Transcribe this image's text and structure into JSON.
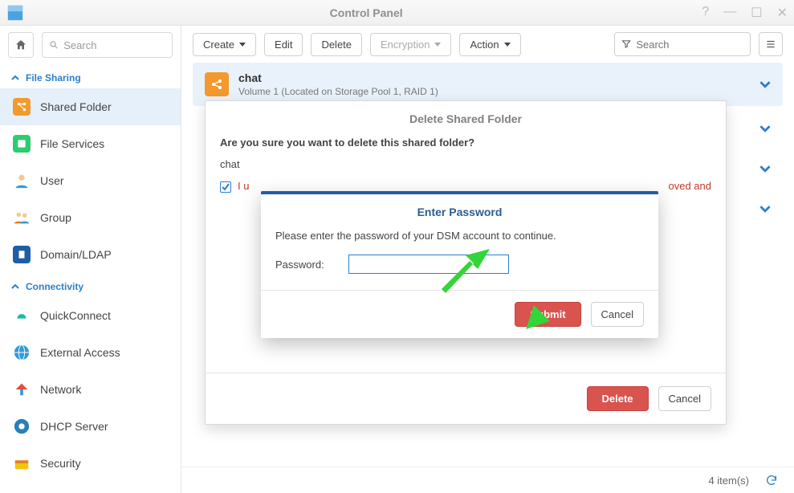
{
  "window": {
    "title": "Control Panel"
  },
  "sidebar": {
    "search_placeholder": "Search",
    "sections": {
      "file_sharing": {
        "label": "File Sharing",
        "items": [
          {
            "label": "Shared Folder",
            "active": true
          },
          {
            "label": "File Services"
          },
          {
            "label": "User"
          },
          {
            "label": "Group"
          },
          {
            "label": "Domain/LDAP"
          }
        ]
      },
      "connectivity": {
        "label": "Connectivity",
        "items": [
          {
            "label": "QuickConnect"
          },
          {
            "label": "External Access"
          },
          {
            "label": "Network"
          },
          {
            "label": "DHCP Server"
          },
          {
            "label": "Security"
          }
        ]
      }
    }
  },
  "toolbar": {
    "create": "Create",
    "edit": "Edit",
    "delete": "Delete",
    "encryption": "Encryption",
    "action": "Action",
    "search_placeholder": "Search"
  },
  "list": {
    "rows": [
      {
        "name": "chat",
        "subtitle": "Volume 1 (Located on Storage Pool 1, RAID 1)",
        "selected": true
      },
      {
        "name": "",
        "subtitle": ""
      },
      {
        "name": "",
        "subtitle": ""
      },
      {
        "name": "",
        "subtitle": ""
      }
    ]
  },
  "statusbar": {
    "count": "4 item(s)"
  },
  "modal_delete": {
    "title": "Delete Shared Folder",
    "question": "Are you sure you want to delete this shared folder?",
    "folder": "chat",
    "confirm_prefix": "I u",
    "confirm_suffix": "oved and",
    "btn_delete": "Delete",
    "btn_cancel": "Cancel"
  },
  "modal_password": {
    "title": "Enter Password",
    "instruction": "Please enter the password of your DSM account to continue.",
    "label": "Password:",
    "btn_submit": "Submit",
    "btn_cancel": "Cancel"
  }
}
